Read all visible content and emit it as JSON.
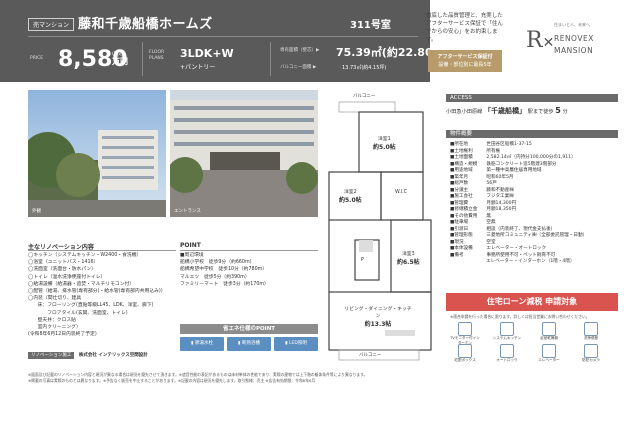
{
  "header": {
    "badge": "売マンション",
    "name": "藤和千歳船橋ホームズ",
    "room": "311号室",
    "price_label": "PRICE",
    "price": "8,580",
    "price_unit_top": "(税込)",
    "price_unit": "万円",
    "floor_label_1": "FLOOR",
    "floor_label_2": "PLANS",
    "plan": "3LDK+W",
    "plan_sub": "+パントリー",
    "area_label": "専有面積（壁芯）▶",
    "area": "75.39㎡(約22.80坪)",
    "balcony_label": "バルコニー面積 ▶",
    "balcony": "13.73㎡(約4.15坪)"
  },
  "promo": {
    "text": "徹底した品質管理と、充実したアフターサービス保証で「住んでからの安心」をお約束します。",
    "gold_line1": "アフターサービス保証付",
    "gold_line2": "設備・部位別に最長5年",
    "logo_tag": "住まいと人、未来へ",
    "logo_line1": "RENOVEX",
    "logo_line2": "MANSION"
  },
  "photos": [
    {
      "caption": "外観"
    },
    {
      "caption": "エントランス"
    }
  ],
  "renovation": {
    "title": "主なリノベーション内容",
    "items": [
      "◯キッチン（システムキッチン・W2400・食洗機）",
      "◯浴室（ユニットバス・1416）",
      "◯洗面室（洗面台・防水パン）",
      "◯トイレ（温水洗浄便座付トイレ）",
      "◯給湯設備（給湯器・追焚・マルチリモコン付）",
      "◯配管（給湯、排水管(専有部分)・給水管(専有部内共用込み)）",
      "◯内装（間仕切り、建具",
      "　　床：フローリング(直貼等級LL45、LDK、洋室、廊下)",
      "　　　　フロアタイル(玄関、洗面室、トイレ)",
      "　　壁天井：クロス貼",
      "　　室内クリーニング）",
      "(令和8年6月12日内装終了予定)"
    ],
    "company_label": "リノベーション施工",
    "company": "株式会社 インテリックス空間設計"
  },
  "point": {
    "title": "POINT",
    "env_title": "■周辺環境",
    "env": [
      "船橋小学校　徒歩9分（約660m）",
      "船橋希望中学校　徒歩10分（約780m）",
      "マルエツ　徒歩5分（約390m）",
      "ファミリーマート　徒歩3分（約170m）"
    ],
    "std_title": "省エネ仕様のPOINT",
    "chips": [
      "節湯水栓",
      "断熱浴槽",
      "LED照明"
    ]
  },
  "floorplan": {
    "balcony_top": "バルコニー",
    "room1": "洋室1",
    "room1_size": "約5.0帖",
    "room2": "洋室2",
    "room2_size": "約5.0帖",
    "room3": "洋室3",
    "room3_size": "約6.5帖",
    "ldk": "リビング・ダイニング・キッチン",
    "ldk_size": "約13.3帖",
    "balcony_bottom": "バルコニー",
    "wic": "W.I.C",
    "pantry": "P"
  },
  "access": {
    "title": "ACCESS",
    "line": "小田急小田原線",
    "station": "「千歳船橋」",
    "walk": "駅まで徒歩",
    "minutes": "5",
    "min_unit": "分"
  },
  "summary": {
    "title": "物件概要",
    "rows": [
      [
        "所在地",
        "世田谷区船橋1-37-15"
      ],
      [
        "土地権利",
        "所有権"
      ],
      [
        "土地面積",
        "2,582.14㎡（内持分100,000分の1,911）"
      ],
      [
        "構造・規模",
        "鉄筋コンクリート造5階建3階部分"
      ],
      [
        "用途地域",
        "第一種中高層住居専用地域"
      ],
      [
        "築年月",
        "昭和60年5月"
      ],
      [
        "総戸数",
        "56戸"
      ],
      [
        "分譲主",
        "藤和不動産㈱"
      ],
      [
        "施工会社",
        "フジタ工業㈱"
      ],
      [
        "管理費",
        "月額14,300円"
      ],
      [
        "修繕積立金",
        "月額18,350円"
      ],
      [
        "その他費用",
        "無"
      ],
      [
        "駐車場",
        "空無"
      ],
      [
        "引渡日",
        "相談（内装終了、現代金支払後）"
      ],
      [
        "管理形態",
        "三菱地所コミュニティ㈱（全部委託管理・日勤）"
      ],
      [
        "現況",
        "空室"
      ],
      [
        "本体設備",
        "エレベーター・オートロック"
      ],
      [
        "備考",
        "事務所使用不可・ペット飼育不可",
        "エレベーター・インターホン（1階・4階）"
      ]
    ]
  },
  "loan": {
    "title": "住宅ローン減税 申請対象",
    "note": "※適合申請を行った場合に限ります。詳しくは担当営業にお問い合わせください。",
    "icons": [
      "TVモニター付インターホン",
      "システムキッチン",
      "浴室乾燥機",
      "洗浄便座",
      "宅配ボックス",
      "オートロック",
      "エレベーター",
      "防犯カメラ"
    ]
  },
  "footer": {
    "lines": [
      "※図面及び記載のリノベーション内容と現況が異なる場合は現況を優先させて頂きます。※遮音性能の表記があるものは床材単体の性能であり、実際の建物では上下階の躯体条件等により異なります。",
      "※掲載の写真は実際のものとは異なります。※予告なく販売を中止することがあります。※記載の内容は現況を優先します。取引態様：売主 ※広告有効期限：令和8年6月"
    ]
  }
}
